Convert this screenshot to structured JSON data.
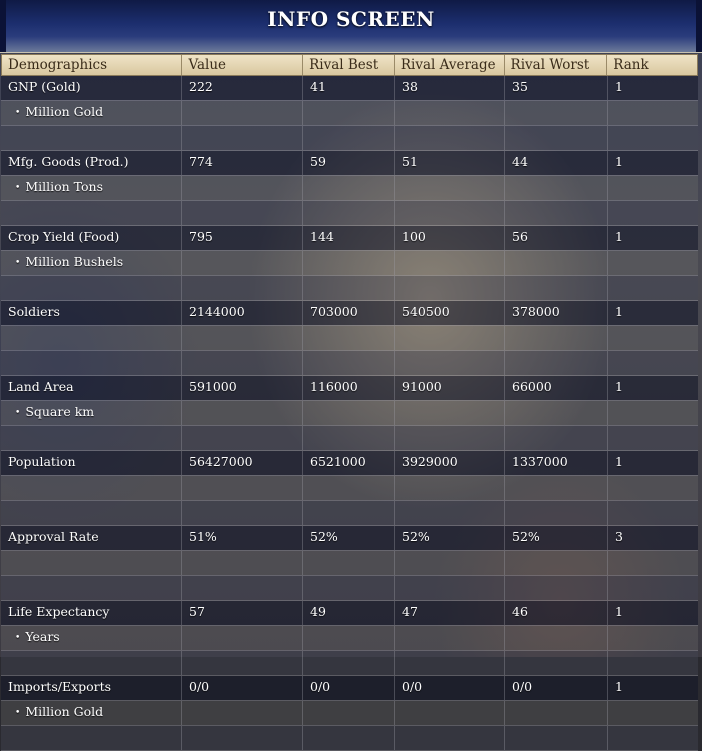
{
  "header": {
    "title": "INFO SCREEN"
  },
  "columns": [
    "Demographics",
    "Value",
    "Rival Best",
    "Rival Average",
    "Rival Worst",
    "Rank"
  ],
  "rows": [
    {
      "label": "GNP (Gold)",
      "values": [
        "222",
        "41",
        "38",
        "35",
        "1"
      ],
      "unit": "Million Gold"
    },
    {
      "label": "Mfg. Goods (Prod.)",
      "values": [
        "774",
        "59",
        "51",
        "44",
        "1"
      ],
      "unit": "Million Tons"
    },
    {
      "label": "Crop Yield (Food)",
      "values": [
        "795",
        "144",
        "100",
        "56",
        "1"
      ],
      "unit": "Million Bushels"
    },
    {
      "label": "Soldiers",
      "values": [
        "2144000",
        "703000",
        "540500",
        "378000",
        "1"
      ],
      "unit": ""
    },
    {
      "label": "Land Area",
      "values": [
        "591000",
        "116000",
        "91000",
        "66000",
        "1"
      ],
      "unit": "Square km"
    },
    {
      "label": "Population",
      "values": [
        "56427000",
        "6521000",
        "3929000",
        "1337000",
        "1"
      ],
      "unit": ""
    },
    {
      "label": "Approval Rate",
      "values": [
        "51%",
        "52%",
        "52%",
        "52%",
        "3"
      ],
      "unit": ""
    },
    {
      "label": "Life Expectancy",
      "values": [
        "57",
        "49",
        "47",
        "46",
        "1"
      ],
      "unit": "Years"
    },
    {
      "label": "Imports/Exports",
      "values": [
        "0/0",
        "0/0",
        "0/0",
        "0/0",
        "1"
      ],
      "unit": "Million Gold"
    }
  ]
}
